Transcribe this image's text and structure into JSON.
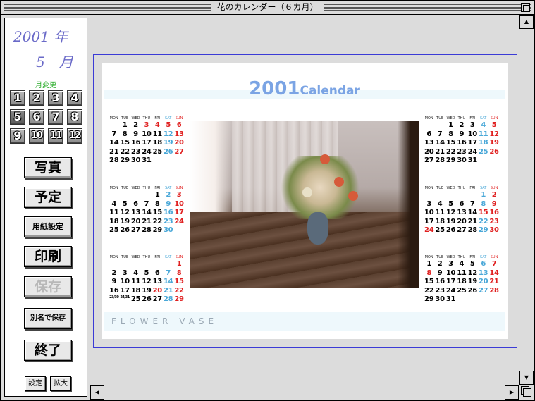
{
  "window": {
    "title": "花のカレンダー（６カ月）"
  },
  "sidebar": {
    "year_label": "2001 年",
    "month_label": "5　月",
    "change_month_label": "月変更",
    "month_buttons": [
      "1",
      "2",
      "3",
      "4",
      "5",
      "6",
      "7",
      "8",
      "9",
      "10",
      "11",
      "12"
    ],
    "selected_month": "5",
    "buttons": {
      "photo": "写真",
      "schedule": "予定",
      "paper_setup": "用紙設定",
      "print": "印刷",
      "save": "保存",
      "save_as": "別名で保存",
      "quit": "終了",
      "settings": "設定",
      "zoom": "拡大"
    }
  },
  "calendar": {
    "title_year": "2001",
    "title_word": "Calendar",
    "footer_text": "FLOWER  VASE",
    "dow": [
      "MON",
      "TUE",
      "WED",
      "THU",
      "FRI",
      "SAT",
      "SUN"
    ],
    "months_left": [
      {
        "weeks": [
          [
            "",
            "",
            "",
            "",
            "",
            "",
            ""
          ],
          [
            "",
            "",
            "",
            "",
            "",
            "",
            ""
          ]
        ]
      }
    ],
    "photo_icon": "flower-vase-photo"
  },
  "months": {
    "may": [
      [
        {
          "d": "",
          "c": ""
        },
        {
          "d": "1",
          "c": ""
        },
        {
          "d": "2",
          "c": ""
        },
        {
          "d": "3",
          "c": "hol"
        },
        {
          "d": "4",
          "c": "hol"
        },
        {
          "d": "5",
          "c": "hol"
        },
        {
          "d": "6",
          "c": "sun"
        }
      ],
      [
        {
          "d": "7",
          "c": ""
        },
        {
          "d": "8",
          "c": ""
        },
        {
          "d": "9",
          "c": ""
        },
        {
          "d": "10",
          "c": ""
        },
        {
          "d": "11",
          "c": ""
        },
        {
          "d": "12",
          "c": "sat"
        },
        {
          "d": "13",
          "c": "sun"
        }
      ],
      [
        {
          "d": "14",
          "c": ""
        },
        {
          "d": "15",
          "c": ""
        },
        {
          "d": "16",
          "c": ""
        },
        {
          "d": "17",
          "c": ""
        },
        {
          "d": "18",
          "c": ""
        },
        {
          "d": "19",
          "c": "sat"
        },
        {
          "d": "20",
          "c": "sun"
        }
      ],
      [
        {
          "d": "21",
          "c": ""
        },
        {
          "d": "22",
          "c": ""
        },
        {
          "d": "23",
          "c": ""
        },
        {
          "d": "24",
          "c": ""
        },
        {
          "d": "25",
          "c": ""
        },
        {
          "d": "26",
          "c": "sat"
        },
        {
          "d": "27",
          "c": "sun"
        }
      ],
      [
        {
          "d": "28",
          "c": ""
        },
        {
          "d": "29",
          "c": ""
        },
        {
          "d": "30",
          "c": ""
        },
        {
          "d": "31",
          "c": ""
        },
        {
          "d": "",
          "c": ""
        },
        {
          "d": "",
          "c": ""
        },
        {
          "d": "",
          "c": ""
        }
      ]
    ],
    "june": [
      [
        {
          "d": "",
          "c": ""
        },
        {
          "d": "",
          "c": ""
        },
        {
          "d": "",
          "c": ""
        },
        {
          "d": "",
          "c": ""
        },
        {
          "d": "1",
          "c": ""
        },
        {
          "d": "2",
          "c": "sat"
        },
        {
          "d": "3",
          "c": "sun"
        }
      ],
      [
        {
          "d": "4",
          "c": ""
        },
        {
          "d": "5",
          "c": ""
        },
        {
          "d": "6",
          "c": ""
        },
        {
          "d": "7",
          "c": ""
        },
        {
          "d": "8",
          "c": ""
        },
        {
          "d": "9",
          "c": "sat"
        },
        {
          "d": "10",
          "c": "sun"
        }
      ],
      [
        {
          "d": "11",
          "c": ""
        },
        {
          "d": "12",
          "c": ""
        },
        {
          "d": "13",
          "c": ""
        },
        {
          "d": "14",
          "c": ""
        },
        {
          "d": "15",
          "c": ""
        },
        {
          "d": "16",
          "c": "sat"
        },
        {
          "d": "17",
          "c": "sun"
        }
      ],
      [
        {
          "d": "18",
          "c": ""
        },
        {
          "d": "19",
          "c": ""
        },
        {
          "d": "20",
          "c": ""
        },
        {
          "d": "21",
          "c": ""
        },
        {
          "d": "22",
          "c": ""
        },
        {
          "d": "23",
          "c": "sat"
        },
        {
          "d": "24",
          "c": "sun"
        }
      ],
      [
        {
          "d": "25",
          "c": ""
        },
        {
          "d": "26",
          "c": ""
        },
        {
          "d": "27",
          "c": ""
        },
        {
          "d": "28",
          "c": ""
        },
        {
          "d": "29",
          "c": ""
        },
        {
          "d": "30",
          "c": "sat"
        },
        {
          "d": "",
          "c": ""
        }
      ]
    ],
    "july": [
      [
        {
          "d": "",
          "c": ""
        },
        {
          "d": "",
          "c": ""
        },
        {
          "d": "",
          "c": ""
        },
        {
          "d": "",
          "c": ""
        },
        {
          "d": "",
          "c": ""
        },
        {
          "d": "",
          "c": ""
        },
        {
          "d": "1",
          "c": "sun"
        }
      ],
      [
        {
          "d": "2",
          "c": ""
        },
        {
          "d": "3",
          "c": ""
        },
        {
          "d": "4",
          "c": ""
        },
        {
          "d": "5",
          "c": ""
        },
        {
          "d": "6",
          "c": ""
        },
        {
          "d": "7",
          "c": "sat"
        },
        {
          "d": "8",
          "c": "sun"
        }
      ],
      [
        {
          "d": "9",
          "c": ""
        },
        {
          "d": "10",
          "c": ""
        },
        {
          "d": "11",
          "c": ""
        },
        {
          "d": "12",
          "c": ""
        },
        {
          "d": "13",
          "c": ""
        },
        {
          "d": "14",
          "c": "sat"
        },
        {
          "d": "15",
          "c": "sun"
        }
      ],
      [
        {
          "d": "16",
          "c": ""
        },
        {
          "d": "17",
          "c": ""
        },
        {
          "d": "18",
          "c": ""
        },
        {
          "d": "19",
          "c": ""
        },
        {
          "d": "20",
          "c": "hol"
        },
        {
          "d": "21",
          "c": "sat"
        },
        {
          "d": "22",
          "c": "sun"
        }
      ],
      [
        {
          "d": "23/30",
          "c": "split"
        },
        {
          "d": "24/31",
          "c": "split"
        },
        {
          "d": "25",
          "c": ""
        },
        {
          "d": "26",
          "c": ""
        },
        {
          "d": "27",
          "c": ""
        },
        {
          "d": "28",
          "c": "sat"
        },
        {
          "d": "29",
          "c": "sun"
        }
      ]
    ],
    "august": [
      [
        {
          "d": "",
          "c": ""
        },
        {
          "d": "",
          "c": ""
        },
        {
          "d": "1",
          "c": ""
        },
        {
          "d": "2",
          "c": ""
        },
        {
          "d": "3",
          "c": ""
        },
        {
          "d": "4",
          "c": "sat"
        },
        {
          "d": "5",
          "c": "sun"
        }
      ],
      [
        {
          "d": "6",
          "c": ""
        },
        {
          "d": "7",
          "c": ""
        },
        {
          "d": "8",
          "c": ""
        },
        {
          "d": "9",
          "c": ""
        },
        {
          "d": "10",
          "c": ""
        },
        {
          "d": "11",
          "c": "sat"
        },
        {
          "d": "12",
          "c": "sun"
        }
      ],
      [
        {
          "d": "13",
          "c": ""
        },
        {
          "d": "14",
          "c": ""
        },
        {
          "d": "15",
          "c": ""
        },
        {
          "d": "16",
          "c": ""
        },
        {
          "d": "17",
          "c": ""
        },
        {
          "d": "18",
          "c": "sat"
        },
        {
          "d": "19",
          "c": "sun"
        }
      ],
      [
        {
          "d": "20",
          "c": ""
        },
        {
          "d": "21",
          "c": ""
        },
        {
          "d": "22",
          "c": ""
        },
        {
          "d": "23",
          "c": ""
        },
        {
          "d": "24",
          "c": ""
        },
        {
          "d": "25",
          "c": "sat"
        },
        {
          "d": "26",
          "c": "sun"
        }
      ],
      [
        {
          "d": "27",
          "c": ""
        },
        {
          "d": "28",
          "c": ""
        },
        {
          "d": "29",
          "c": ""
        },
        {
          "d": "30",
          "c": ""
        },
        {
          "d": "31",
          "c": ""
        },
        {
          "d": "",
          "c": ""
        },
        {
          "d": "",
          "c": ""
        }
      ]
    ],
    "september": [
      [
        {
          "d": "",
          "c": ""
        },
        {
          "d": "",
          "c": ""
        },
        {
          "d": "",
          "c": ""
        },
        {
          "d": "",
          "c": ""
        },
        {
          "d": "",
          "c": ""
        },
        {
          "d": "1",
          "c": "sat"
        },
        {
          "d": "2",
          "c": "sun"
        }
      ],
      [
        {
          "d": "3",
          "c": ""
        },
        {
          "d": "4",
          "c": ""
        },
        {
          "d": "5",
          "c": ""
        },
        {
          "d": "6",
          "c": ""
        },
        {
          "d": "7",
          "c": ""
        },
        {
          "d": "8",
          "c": "sat"
        },
        {
          "d": "9",
          "c": "sun"
        }
      ],
      [
        {
          "d": "10",
          "c": ""
        },
        {
          "d": "11",
          "c": ""
        },
        {
          "d": "12",
          "c": ""
        },
        {
          "d": "13",
          "c": ""
        },
        {
          "d": "14",
          "c": ""
        },
        {
          "d": "15",
          "c": "hol"
        },
        {
          "d": "16",
          "c": "sun"
        }
      ],
      [
        {
          "d": "17",
          "c": ""
        },
        {
          "d": "18",
          "c": ""
        },
        {
          "d": "19",
          "c": ""
        },
        {
          "d": "20",
          "c": ""
        },
        {
          "d": "21",
          "c": ""
        },
        {
          "d": "22",
          "c": "sat"
        },
        {
          "d": "23",
          "c": "sun"
        }
      ],
      [
        {
          "d": "24",
          "c": "hol"
        },
        {
          "d": "25",
          "c": ""
        },
        {
          "d": "26",
          "c": ""
        },
        {
          "d": "27",
          "c": ""
        },
        {
          "d": "28",
          "c": ""
        },
        {
          "d": "29",
          "c": "sat"
        },
        {
          "d": "30",
          "c": "sun"
        }
      ]
    ],
    "october": [
      [
        {
          "d": "1",
          "c": ""
        },
        {
          "d": "2",
          "c": ""
        },
        {
          "d": "3",
          "c": ""
        },
        {
          "d": "4",
          "c": ""
        },
        {
          "d": "5",
          "c": ""
        },
        {
          "d": "6",
          "c": "sat"
        },
        {
          "d": "7",
          "c": "sun"
        }
      ],
      [
        {
          "d": "8",
          "c": "hol"
        },
        {
          "d": "9",
          "c": ""
        },
        {
          "d": "10",
          "c": ""
        },
        {
          "d": "11",
          "c": ""
        },
        {
          "d": "12",
          "c": ""
        },
        {
          "d": "13",
          "c": "sat"
        },
        {
          "d": "14",
          "c": "sun"
        }
      ],
      [
        {
          "d": "15",
          "c": ""
        },
        {
          "d": "16",
          "c": ""
        },
        {
          "d": "17",
          "c": ""
        },
        {
          "d": "18",
          "c": ""
        },
        {
          "d": "19",
          "c": ""
        },
        {
          "d": "20",
          "c": "sat"
        },
        {
          "d": "21",
          "c": "sun"
        }
      ],
      [
        {
          "d": "22",
          "c": ""
        },
        {
          "d": "23",
          "c": ""
        },
        {
          "d": "24",
          "c": ""
        },
        {
          "d": "25",
          "c": ""
        },
        {
          "d": "26",
          "c": ""
        },
        {
          "d": "27",
          "c": "sat"
        },
        {
          "d": "28",
          "c": "sun"
        }
      ],
      [
        {
          "d": "29",
          "c": ""
        },
        {
          "d": "30",
          "c": ""
        },
        {
          "d": "31",
          "c": ""
        },
        {
          "d": "",
          "c": ""
        },
        {
          "d": "",
          "c": ""
        },
        {
          "d": "",
          "c": ""
        },
        {
          "d": "",
          "c": ""
        }
      ]
    ]
  },
  "icons": {
    "zoom_box": "zoom-box-icon",
    "up": "arrow-up-icon",
    "down": "arrow-down-icon",
    "left": "arrow-left-icon",
    "right": "arrow-right-icon",
    "grow": "size-box-icon"
  },
  "colors": {
    "title_blue": "#7ba4e4",
    "sat": "#4aa8d8",
    "sun": "#e02020",
    "frame": "#3b3bd6",
    "sidebar_year": "#6a6ac8",
    "month_change": "#22aa22"
  }
}
